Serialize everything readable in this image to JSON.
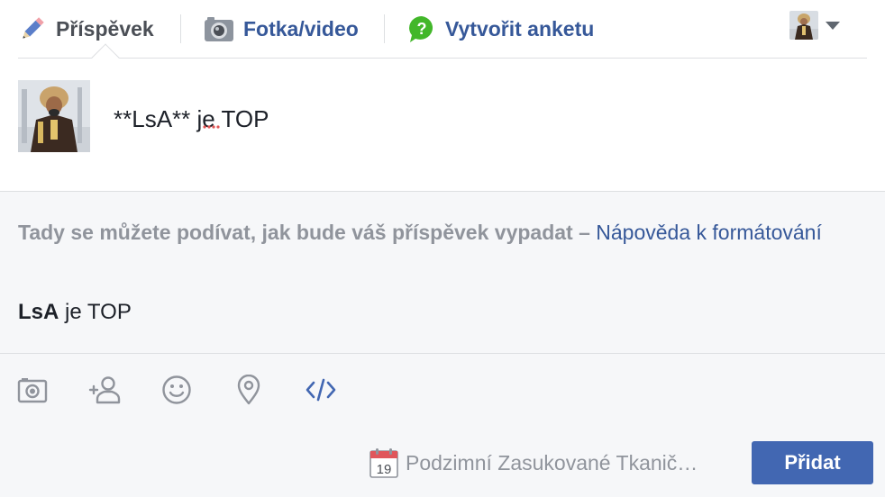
{
  "tabs": {
    "post_label": "Příspěvek",
    "photo_label": "Fotka/video",
    "poll_label": "Vytvořit anketu"
  },
  "composer": {
    "text": "**LsA** je TOP"
  },
  "preview": {
    "note": "Tady se můžete podívat, jak bude váš příspěvek vypadat –",
    "help_link": "Nápověda k formátování",
    "result_bold": "LsA",
    "result_rest": " je TOP"
  },
  "footer": {
    "calendar_day": "19",
    "page_name": "Podzimní Zasukované Tkanič…",
    "submit_label": "Přidat"
  },
  "colors": {
    "accent": "#4267b2",
    "link": "#365899",
    "muted": "#90949c",
    "background": "#f6f7f9"
  },
  "icons": [
    "pencil-icon",
    "camera-icon",
    "poll-icon",
    "caret-down-icon",
    "photo-icon",
    "tag-friends-icon",
    "emoji-icon",
    "location-icon",
    "code-icon",
    "calendar-icon"
  ]
}
